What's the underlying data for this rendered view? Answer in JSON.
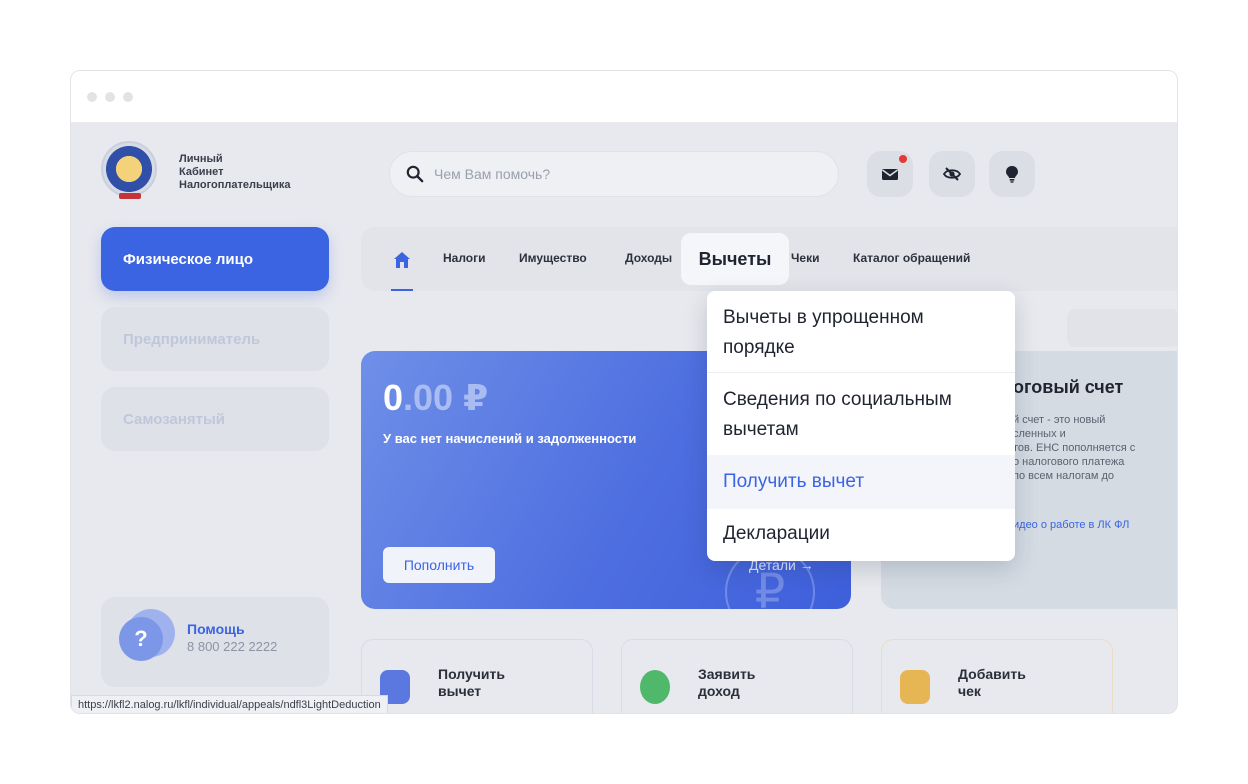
{
  "brand": {
    "line1": "Личный",
    "line2": "Кабинет",
    "line3": "Налогоплательщика"
  },
  "search": {
    "placeholder": "Чем Вам помочь?"
  },
  "header_icons": [
    "mail-icon",
    "eye-off-icon",
    "lightbulb-icon"
  ],
  "sidebar": {
    "items": [
      {
        "label": "Физическое лицо",
        "active": true
      },
      {
        "label": "Предприниматель",
        "active": false
      },
      {
        "label": "Самозанятый",
        "active": false
      }
    ],
    "help": {
      "title": "Помощь",
      "phone": "8 800 222 2222"
    }
  },
  "nav": {
    "items": [
      "Налоги",
      "Имущество",
      "Доходы",
      "Вычеты",
      "Чеки",
      "Каталог обращений"
    ],
    "active": "Вычеты"
  },
  "dropdown": {
    "items": [
      {
        "line1": "Вычеты в упрощенном",
        "line2": "порядке"
      },
      {
        "line1": "Сведения по социальным",
        "line2": "вычетам"
      },
      {
        "line1": "Получить вычет",
        "highlighted": true
      },
      {
        "line1": "Декларации"
      }
    ]
  },
  "balance": {
    "int": "0",
    "frac": ".00",
    "currency": "₽",
    "subtitle": "У вас нет начислений и задолженности",
    "topup_label": "Пополнить",
    "details_label": "Детали →"
  },
  "ens": {
    "title": "оговый счет",
    "text": "й счет - это новый\nсленных и\nтов. ЕНС пополняется с\nо налогового платежа\nпо всем налогам до",
    "link": "идео о работе в ЛК ФЛ"
  },
  "cards": [
    {
      "line1": "Получить",
      "line2": "вычет"
    },
    {
      "line1": "Заявить",
      "line2": "доход"
    },
    {
      "line1": "Добавить",
      "line2": "чек"
    }
  ],
  "status_url": "https://lkfl2.nalog.ru/lkfl/individual/appeals/ndfl3LightDeduction",
  "colors": {
    "accent": "#3b64e3",
    "notification": "#e53935"
  }
}
